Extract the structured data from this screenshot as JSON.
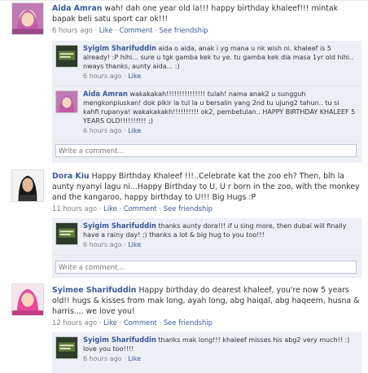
{
  "posts": [
    {
      "author": "Aida Amran",
      "text": "wah! dah one year old la!!! happy birthday khaleef!!! mintak bapak beli satu sport car ok!!!",
      "time": "6 hours ago",
      "sep": " · ",
      "like": "Like",
      "comment": "Comment",
      "friendship": "See friendship",
      "replies": [
        {
          "author": "Syigim Sharifuddin",
          "text": "aida o aida, anak i yg mana u nk wish ni. khaleef is 5 already! :P hihi... sure u tgk gamba kek tu ye. tu gamba kek dia masa 1yr old hihi.. nways thanks, aunty aida... :)",
          "time": "6 hours ago",
          "like": "Like"
        },
        {
          "author": "Aida Amran",
          "text": "wakakakah!!!!!!!!!!!!!!! tulah! nama anak2 u sungguh mengkonpiuskan! dok pikir la tul la u bersalin yang 2nd tu ujung2 tahun.. tu si kahfi rupanya! wakakakakh!!!!!!!!!! ok2, pembetulan.. HAPPY BIRTHDAY KHALEEF 5 YEARS OLD!!!!!!!!!! ;)",
          "time": "6 hours ago",
          "like": "Like"
        }
      ],
      "write_placeholder": "Write a comment..."
    },
    {
      "author": "Dora Kiu",
      "text": "Happy Birthday Khaleef !!!..Celebrate kat the zoo eh? Then, blh la aunty nyanyi lagu ni...Happy Birthday to U, U r born in the zoo, with the monkey and the kangaroo, happy birthday to U!!! Big Hugs :P",
      "time": "11 hours ago",
      "sep": " · ",
      "like": "Like",
      "comment": "Comment",
      "friendship": "See friendship",
      "replies": [
        {
          "author": "Syigim Sharifuddin",
          "text": "thanks aunty dora!!! if u sing more, then dubai will finally have a rainy day! ;) thanks a lot & big hug to you too!!!",
          "time": "6 hours ago",
          "like": "Like"
        }
      ],
      "write_placeholder": "Write a comment..."
    },
    {
      "author": "Syimee Sharifuddin",
      "text": "Happy birthday do dearest khaleef, you're now 5 years old!! hugs & kisses from mak long, ayah long, abg haiqal, abg haqeem, husna & harris.... we love you!",
      "time": "12 hours ago",
      "sep": " · ",
      "like": "Like",
      "comment": "Comment",
      "friendship": "See friendship",
      "replies": [
        {
          "author": "Syigim Sharifuddin",
          "text": "thanks mak long!!! khaleef misses his abg2 very much!! :) love you too!!!!",
          "time": "6 hours ago",
          "like": "Like"
        }
      ]
    }
  ],
  "colors": {
    "link": "#3b5998",
    "thread_bg": "#eceff5",
    "meta": "#808080"
  }
}
